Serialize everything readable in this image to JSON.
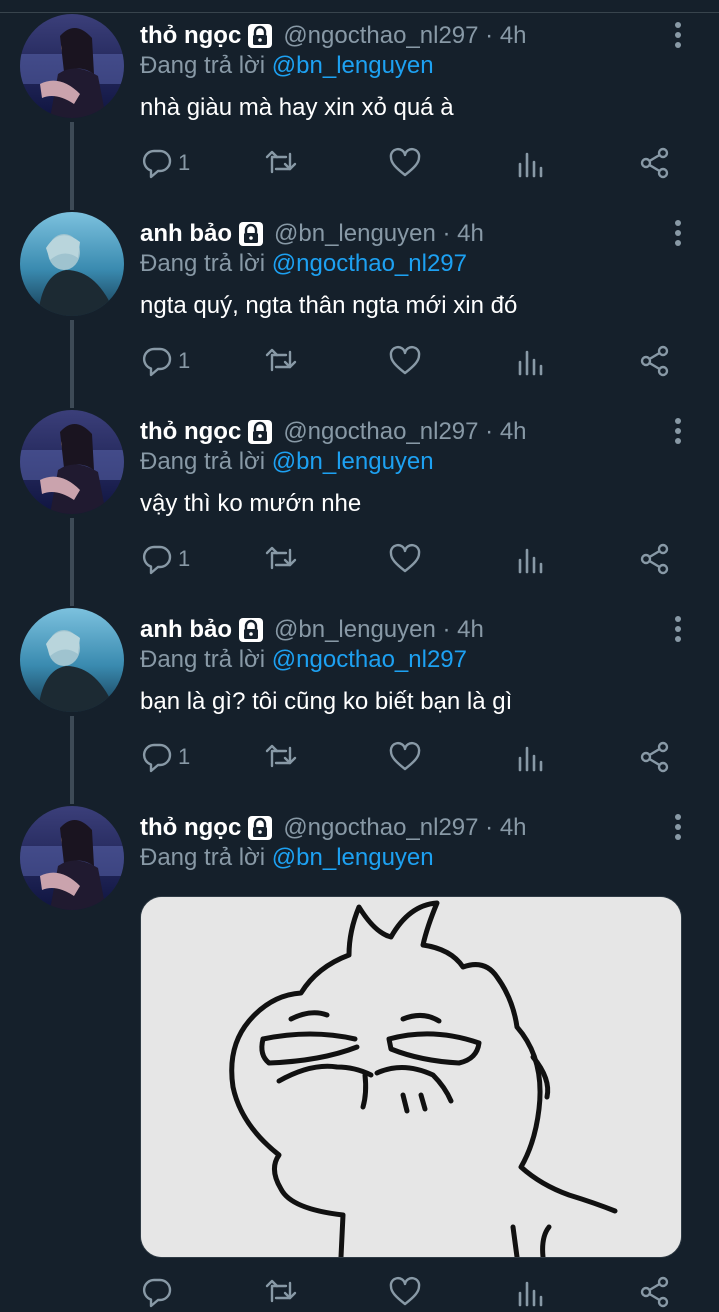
{
  "tweets": [
    {
      "name": "thỏ ngọc",
      "handle": "@ngocthao_nl297 · 4h",
      "replying_prefix": "Đang trả lời",
      "replying_to": "@bn_lenguyen",
      "text": "nhà giàu mà hay xin xỏ quá à",
      "reply_count": "1"
    },
    {
      "name": "anh bảo",
      "handle": "@bn_lenguyen · 4h",
      "replying_prefix": "Đang trả lời",
      "replying_to": "@ngocthao_nl297",
      "text": "ngta quý, ngta thân ngta mới xin đó",
      "reply_count": "1"
    },
    {
      "name": "thỏ ngọc",
      "handle": "@ngocthao_nl297 · 4h",
      "replying_prefix": "Đang trả lời",
      "replying_to": "@bn_lenguyen",
      "text": "vậy thì ko mướn nhe",
      "reply_count": "1"
    },
    {
      "name": "anh bảo",
      "handle": "@bn_lenguyen · 4h",
      "replying_prefix": "Đang trả lời",
      "replying_to": "@ngocthao_nl297",
      "text": "bạn là gì? tôi cũng ko biết bạn là gì",
      "reply_count": "1"
    },
    {
      "name": "thỏ ngọc",
      "handle": "@ngocthao_nl297 · 4h",
      "replying_prefix": "Đang trả lời",
      "replying_to": "@bn_lenguyen",
      "text": "",
      "reply_count": ""
    }
  ],
  "icons": {
    "reply": "reply-icon",
    "retweet": "retweet-icon",
    "like": "heart-icon",
    "views": "analytics-icon",
    "share": "share-icon",
    "lock": "lock-icon",
    "more": "more-vertical-icon"
  },
  "colors": {
    "background": "#15202b",
    "text": "#ffffff",
    "muted": "#8899a6",
    "mention": "#1da1f2",
    "thread_line": "#3d4a56"
  }
}
